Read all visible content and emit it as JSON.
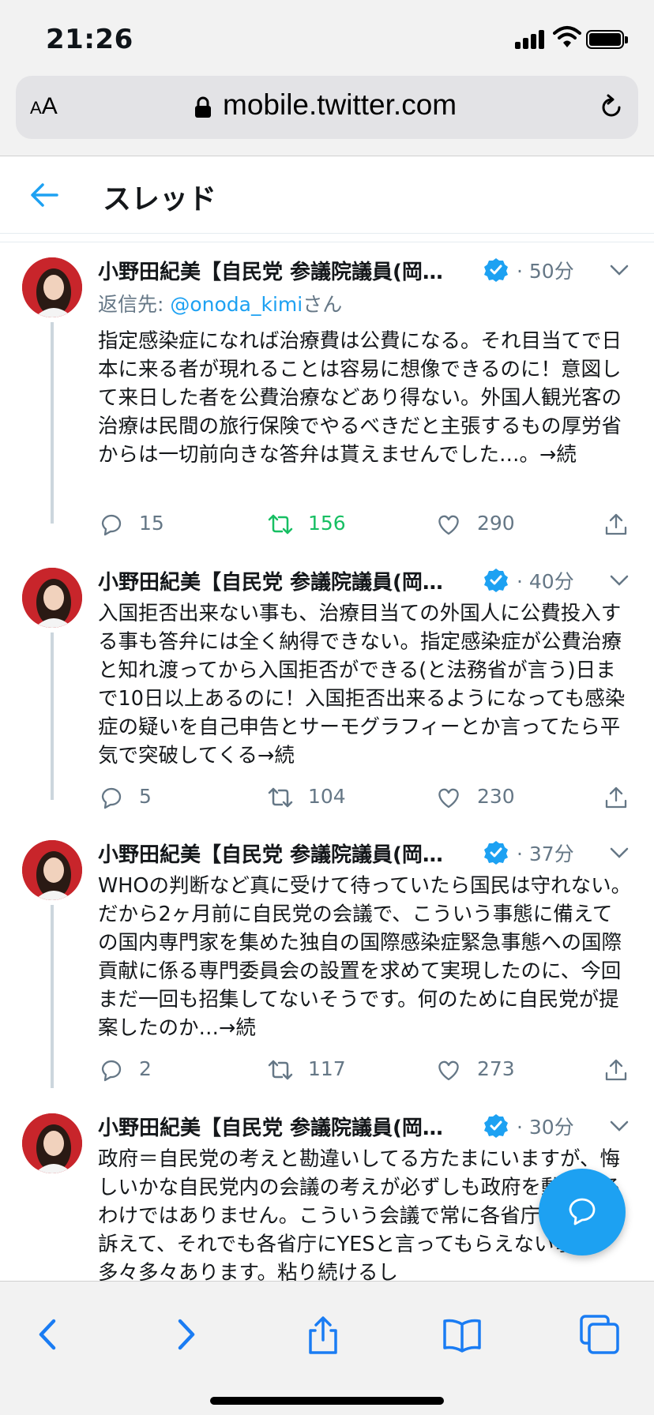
{
  "status_bar": {
    "time": "21:26"
  },
  "browser": {
    "text_size_label": "AA",
    "url": "mobile.twitter.com"
  },
  "header": {
    "title": "スレッド"
  },
  "tweets": [
    {
      "author": "小野田紀美【自民党 参議院議員(岡…",
      "time": "· 50分",
      "reply_prefix": "返信先: ",
      "reply_handle": "@onoda_kimi",
      "reply_suffix": "さん",
      "text": "指定感染症になれば治療費は公費になる。それ目当てで日本に来る者が現れることは容易に想像できるのに！意図して来日した者を公費治療などあり得ない。外国人観光客の治療は民間の旅行保険でやるべきだと主張するもの厚労省からは一切前向きな答弁は貰えませんでした…。→続",
      "replies": "15",
      "retweets": "156",
      "likes": "290"
    },
    {
      "author": "小野田紀美【自民党 参議院議員(岡…",
      "time": "· 40分",
      "text": "入国拒否出来ない事も、治療目当ての外国人に公費投入する事も答弁には全く納得できない。指定感染症が公費治療と知れ渡ってから入国拒否ができる(と法務省が言う)日まで10日以上あるのに！入国拒否出来るようになっても感染症の疑いを自己申告とサーモグラフィーとか言ってたら平気で突破してくる→続",
      "replies": "5",
      "retweets": "104",
      "likes": "230"
    },
    {
      "author": "小野田紀美【自民党 参議院議員(岡…",
      "time": "· 37分",
      "text": "WHOの判断など真に受けて待っていたら国民は守れない。だから2ヶ月前に自民党の会議で、こういう事態に備えての国内専門家を集めた独自の国際感染症緊急事態への国際貢献に係る専門委員会の設置を求めて実現したのに、今回まだ一回も招集してないそうです。何のために自民党が提案したのか…→続",
      "replies": "2",
      "retweets": "117",
      "likes": "273"
    },
    {
      "author": "小野田紀美【自民党 参議院議員(岡…",
      "time": "· 30分",
      "text": "政府＝自民党の考えと勘違いしてる方たまにいますが、悔しいかな自民党内の会議の考えが必ずしも政府を動かせるわけではありません。こういう会議で常に各省庁に改善を訴えて、それでも各省庁にYESと言ってもらえない事も多々多々あります。粘り続けるし"
    }
  ],
  "colors": {
    "accent": "#1da1f2",
    "retweet_active": "#17bf63",
    "muted": "#657786",
    "verified": "#1da1f2"
  },
  "icons": [
    "back-arrow-icon",
    "verified-badge-icon",
    "chevron-down-icon",
    "reply-icon",
    "retweet-icon",
    "like-icon",
    "share-icon",
    "compose-icon",
    "lock-icon",
    "reload-icon",
    "browser-back-icon",
    "browser-forward-icon",
    "browser-share-icon",
    "bookmarks-icon",
    "tabs-icon"
  ]
}
